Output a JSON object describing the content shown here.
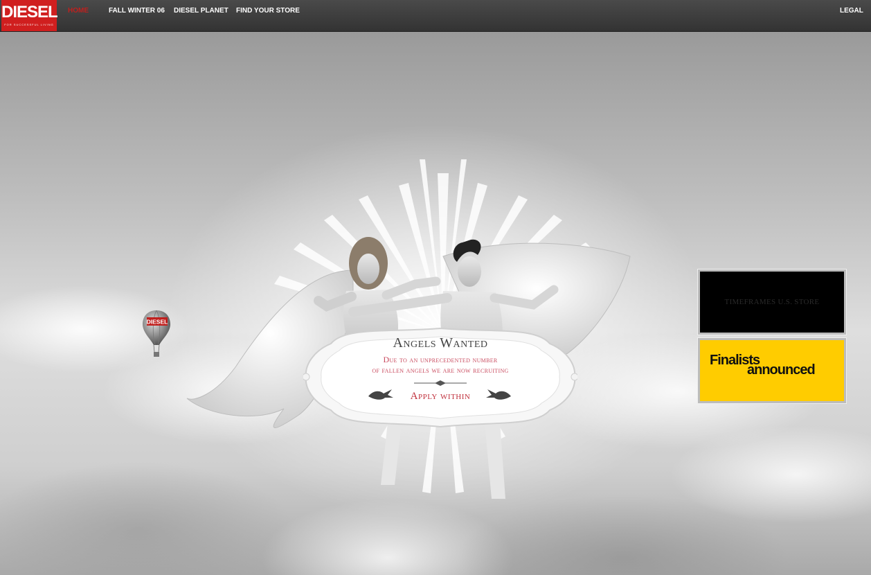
{
  "nav": {
    "brand": "DIESEL",
    "tagline": "FOR SUCCESSFUL LIVING",
    "items": [
      {
        "label": "HOME",
        "active": true
      },
      {
        "label": "FALL WINTER 06"
      },
      {
        "label": "DIESEL PLANET"
      },
      {
        "label": "FIND YOUR STORE"
      }
    ],
    "legal": "LEGAL"
  },
  "balloon": {
    "label": "DIESEL"
  },
  "hero": {
    "headline": "Angels Wanted",
    "line1": "Due to an unprecedented number",
    "line2": "of fallen angels we are now recruiting",
    "cta": "Apply within"
  },
  "promos": {
    "store": "TIMEFRAMES U.S. STORE",
    "finalists_line1": "Finalists",
    "finalists_line2": "announced"
  },
  "colors": {
    "brand_red": "#d01f1f",
    "nav_bg": "#3c3c3c",
    "accent_pink": "#c94a5e",
    "promo_yellow": "#ffcc00"
  }
}
